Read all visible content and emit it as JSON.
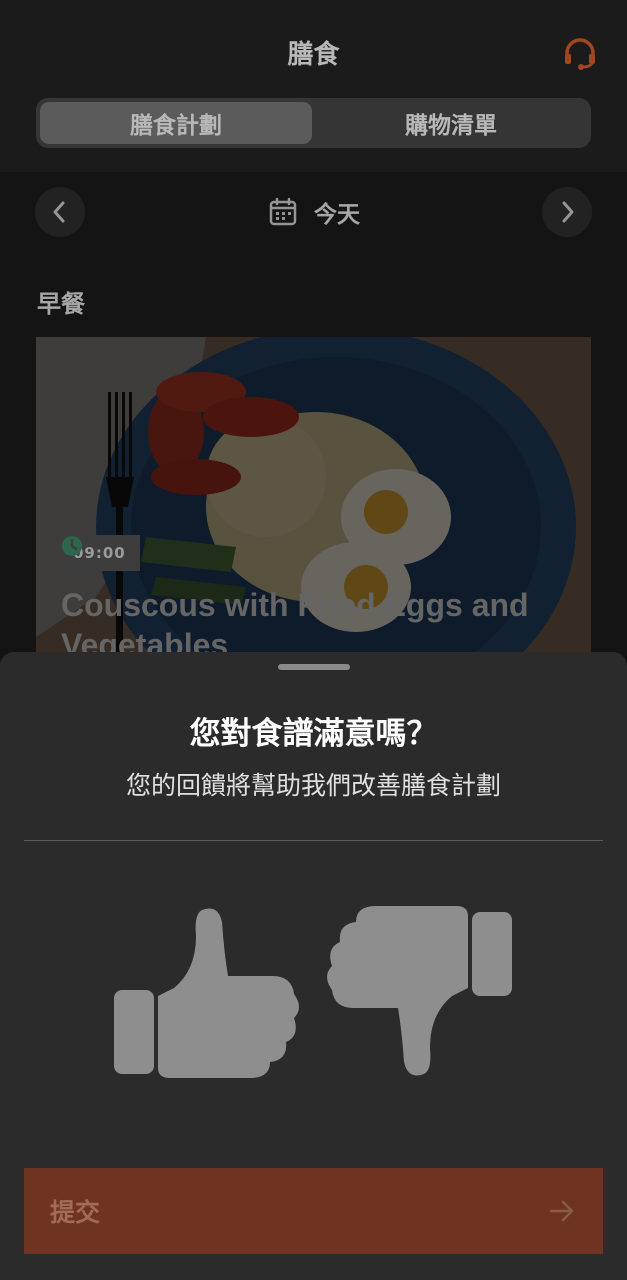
{
  "header": {
    "title": "膳食",
    "support_icon": "headset-icon",
    "tabs": [
      {
        "label": "膳食計劃",
        "active": true
      },
      {
        "label": "購物清單",
        "active": false
      }
    ]
  },
  "date_nav": {
    "label": "今天",
    "prev_icon": "chevron-left-icon",
    "next_icon": "chevron-right-icon",
    "calendar_icon": "calendar-icon"
  },
  "meal_section": {
    "title": "早餐",
    "card": {
      "time": "09:00",
      "title": "Couscous with Fried Eggs and Vegetables"
    }
  },
  "feedback_sheet": {
    "title": "您對食譜滿意嗎？",
    "subtitle": "您的回饋將幫助我們改善膳食計劃",
    "thumbs_up_icon": "thumbs-up-icon",
    "thumbs_down_icon": "thumbs-down-icon",
    "submit_label": "提交",
    "submit_icon": "arrow-right-icon"
  },
  "colors": {
    "accent": "#e0622d",
    "submit_bg": "#6e3421",
    "sheet_bg": "#2b2b2b"
  }
}
